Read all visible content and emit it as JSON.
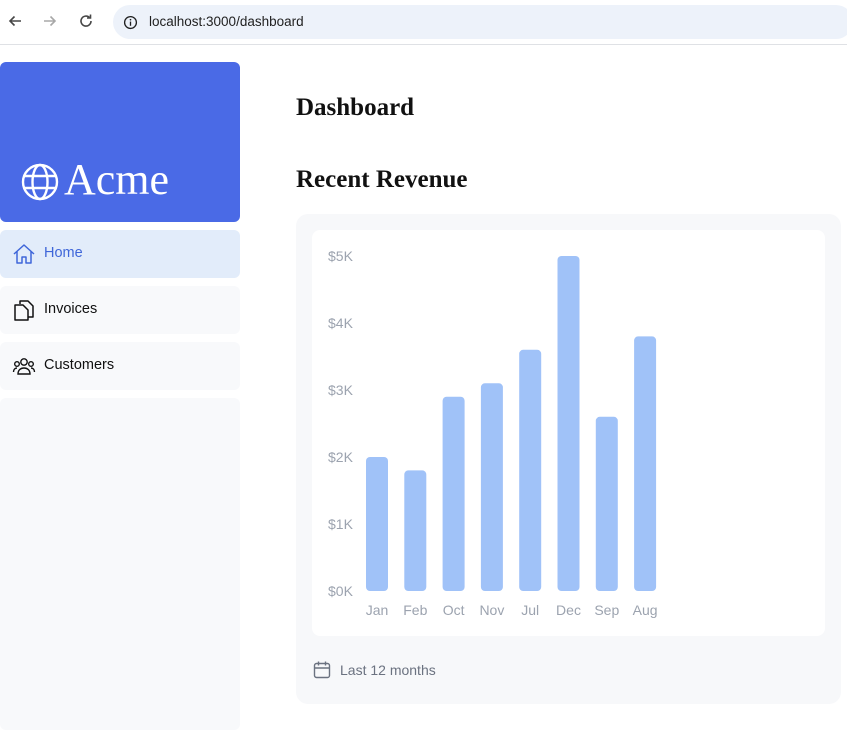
{
  "browser": {
    "url": "localhost:3000/dashboard",
    "icons": [
      "back-arrow-icon",
      "forward-arrow-icon",
      "reload-icon",
      "site-info-icon"
    ]
  },
  "sidebar": {
    "logo_text": "Acme",
    "brand_color": "#4a6ae6",
    "items": [
      {
        "label": "Home",
        "icon": "home-icon",
        "active": true
      },
      {
        "label": "Invoices",
        "icon": "document-icon",
        "active": false
      },
      {
        "label": "Customers",
        "icon": "users-icon",
        "active": false
      }
    ]
  },
  "main": {
    "title": "Dashboard",
    "revenue_section": {
      "title": "Recent Revenue",
      "footer_text": "Last 12 months",
      "footer_icon": "calendar-icon"
    }
  },
  "chart_data": {
    "type": "bar",
    "categories": [
      "Jan",
      "Feb",
      "Oct",
      "Nov",
      "Jul",
      "Dec",
      "Sep",
      "Aug"
    ],
    "values": [
      2000,
      1800,
      2900,
      3100,
      3600,
      5000,
      2600,
      3800
    ],
    "ylim": [
      0,
      5000
    ],
    "y_ticks": [
      "$5K",
      "$4K",
      "$3K",
      "$2K",
      "$1K",
      "$0K"
    ],
    "y_tick_values": [
      5000,
      4000,
      3000,
      2000,
      1000,
      0
    ],
    "bar_color": "#a0c2f8",
    "grid": false
  }
}
